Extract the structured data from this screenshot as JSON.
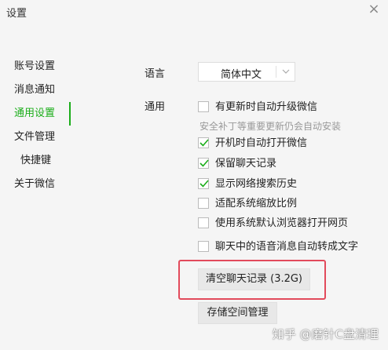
{
  "window": {
    "title": "设置",
    "close_glyph": "×"
  },
  "sidebar": {
    "items": [
      {
        "label": "账号设置",
        "active": false
      },
      {
        "label": "消息通知",
        "active": false
      },
      {
        "label": "通用设置",
        "active": true
      },
      {
        "label": "文件管理",
        "active": false
      },
      {
        "label": "快捷键",
        "active": false
      },
      {
        "label": "关于微信",
        "active": false
      }
    ]
  },
  "general": {
    "language_label": "语言",
    "language_value": "简体中文",
    "general_label": "通用",
    "options": [
      {
        "label": "有更新时自动升级微信",
        "checked": false
      },
      {
        "label": "开机时自动打开微信",
        "checked": true
      },
      {
        "label": "保留聊天记录",
        "checked": true
      },
      {
        "label": "显示网络搜索历史",
        "checked": true
      },
      {
        "label": "适配系统缩放比例",
        "checked": false
      },
      {
        "label": "使用系统默认浏览器打开网页",
        "checked": false
      },
      {
        "label": "聊天中的语音消息自动转成文字",
        "checked": false
      }
    ],
    "update_hint": "安全补丁等重要更新仍会自动安装",
    "clear_chat_button": "清空聊天记录 (3.2G)",
    "storage_button": "存储空间管理"
  },
  "watermark": "知乎 @磨针C盘清理",
  "colors": {
    "accent": "#1aad19",
    "highlight": "#e24a5b",
    "background": "#f5f5f5"
  }
}
